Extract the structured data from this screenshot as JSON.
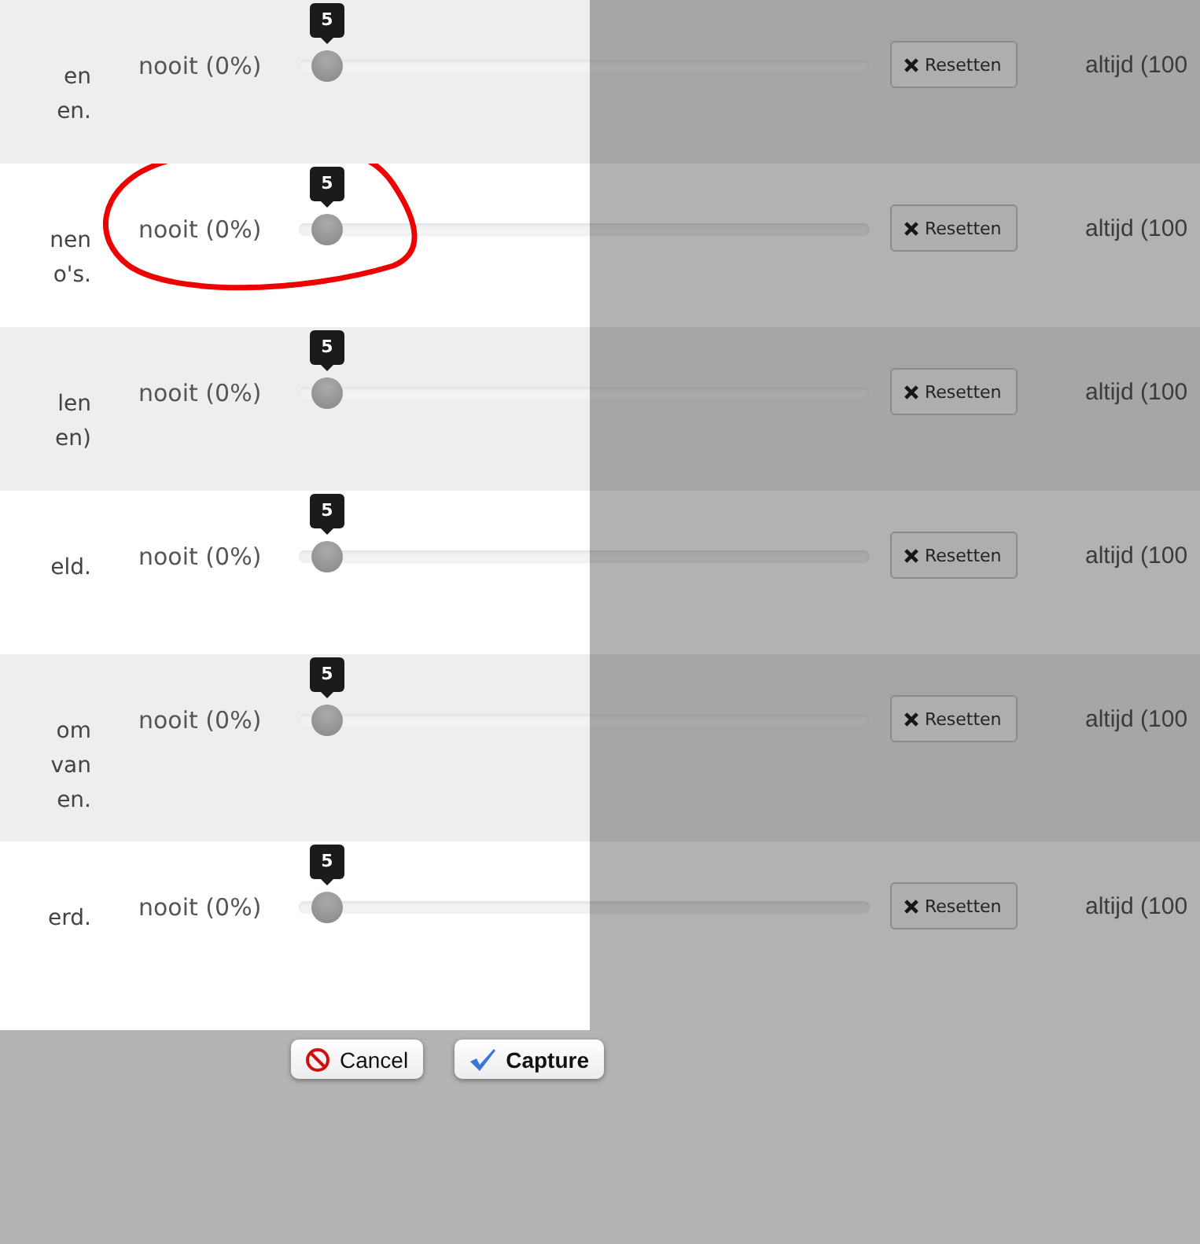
{
  "rows": [
    {
      "description_lines": [
        "en",
        "en."
      ],
      "min_label": "nooit (0%)",
      "slider": {
        "level": 0,
        "tooltip": "5"
      },
      "reset_button": "Resetten",
      "max_label": "altijd (100",
      "circled": false
    },
    {
      "description_lines": [
        "nen",
        "o's."
      ],
      "min_label": "nooit (0%)",
      "slider": {
        "level": 0,
        "tooltip": "5"
      },
      "reset_button": "Resetten",
      "max_label": "altijd (100",
      "circled": true
    },
    {
      "description_lines": [
        "len",
        "en)"
      ],
      "min_label": "nooit (0%)",
      "slider": {
        "level": 0,
        "tooltip": "5"
      },
      "reset_button": "Resetten",
      "max_label": "altijd (100",
      "circled": false
    },
    {
      "description_lines": [
        "eld."
      ],
      "min_label": "nooit (0%)",
      "slider": {
        "level": 0,
        "tooltip": "5"
      },
      "reset_button": "Resetten",
      "max_label": "altijd (100",
      "circled": false
    },
    {
      "description_lines": [
        "om",
        "van",
        "en."
      ],
      "min_label": "nooit (0%)",
      "slider": {
        "level": 0,
        "tooltip": "5"
      },
      "reset_button": "Resetten",
      "max_label": "altijd (100",
      "circled": false
    },
    {
      "description_lines": [
        "erd."
      ],
      "min_label": "nooit (0%)",
      "slider": {
        "level": 0,
        "tooltip": "5"
      },
      "reset_button": "Resetten",
      "max_label": "altijd (100",
      "circled": false
    }
  ],
  "capture_buttons": [
    {
      "kind": "cancel",
      "label": "Cancel"
    },
    {
      "kind": "capture",
      "label": "Capture"
    }
  ]
}
